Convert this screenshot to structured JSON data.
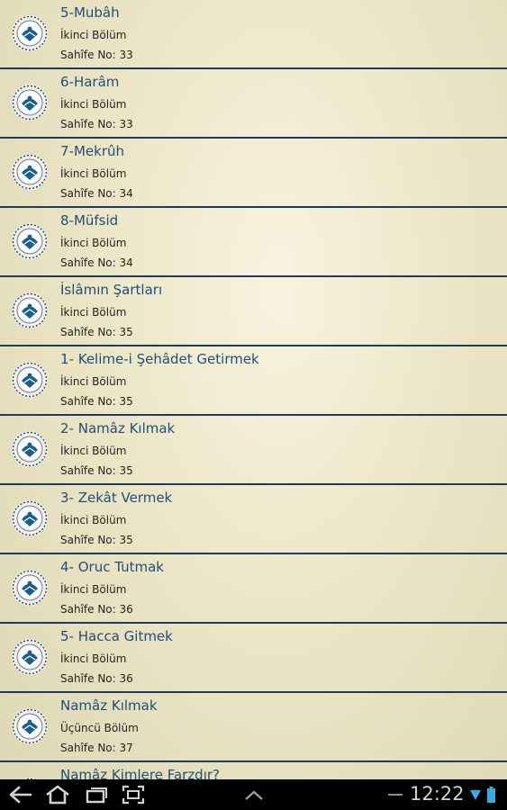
{
  "items": [
    {
      "title": "5-Mubâh",
      "section": "İkinci Bölüm",
      "page": "Sahîfe No: 33"
    },
    {
      "title": "6-Harâm",
      "section": "İkinci Bölüm",
      "page": "Sahîfe No: 33"
    },
    {
      "title": "7-Mekrûh",
      "section": "İkinci Bölüm",
      "page": "Sahîfe No: 34"
    },
    {
      "title": "8-Müfsid",
      "section": "İkinci Bölüm",
      "page": "Sahîfe No: 34"
    },
    {
      "title": "İslâmın Şartları",
      "section": "İkinci Bölüm",
      "page": "Sahîfe No: 35"
    },
    {
      "title": "1- Kelime-i Şehâdet Getirmek",
      "section": "İkinci Bölüm",
      "page": "Sahîfe No: 35"
    },
    {
      "title": "2- Namâz Kılmak",
      "section": "İkinci Bölüm",
      "page": "Sahîfe No: 35"
    },
    {
      "title": "3- Zekât Vermek",
      "section": "İkinci Bölüm",
      "page": "Sahîfe No: 35"
    },
    {
      "title": "4- Oruc Tutmak",
      "section": "İkinci Bölüm",
      "page": "Sahîfe No: 36"
    },
    {
      "title": "5- Hacca Gitmek",
      "section": "İkinci Bölüm",
      "page": "Sahîfe No: 36"
    },
    {
      "title": "Namâz Kılmak",
      "section": "Üçüncü Bölüm",
      "page": "Sahîfe No: 37"
    },
    {
      "title": "Namâz Kimlere Farzdır?",
      "section": "",
      "page": ""
    }
  ],
  "status": {
    "time": "12:22"
  },
  "icons": {
    "list_logo": "book-emblem-icon",
    "back": "back-icon",
    "home": "home-icon",
    "recents": "recent-apps-icon",
    "screenshot": "screenshot-icon",
    "up": "chevron-up-icon",
    "wifi": "wifi-icon",
    "battery": "battery-icon"
  },
  "colors": {
    "title": "#1f4f78",
    "divider": "#1d3c5c",
    "logo_blue": "#1b5e8a"
  }
}
